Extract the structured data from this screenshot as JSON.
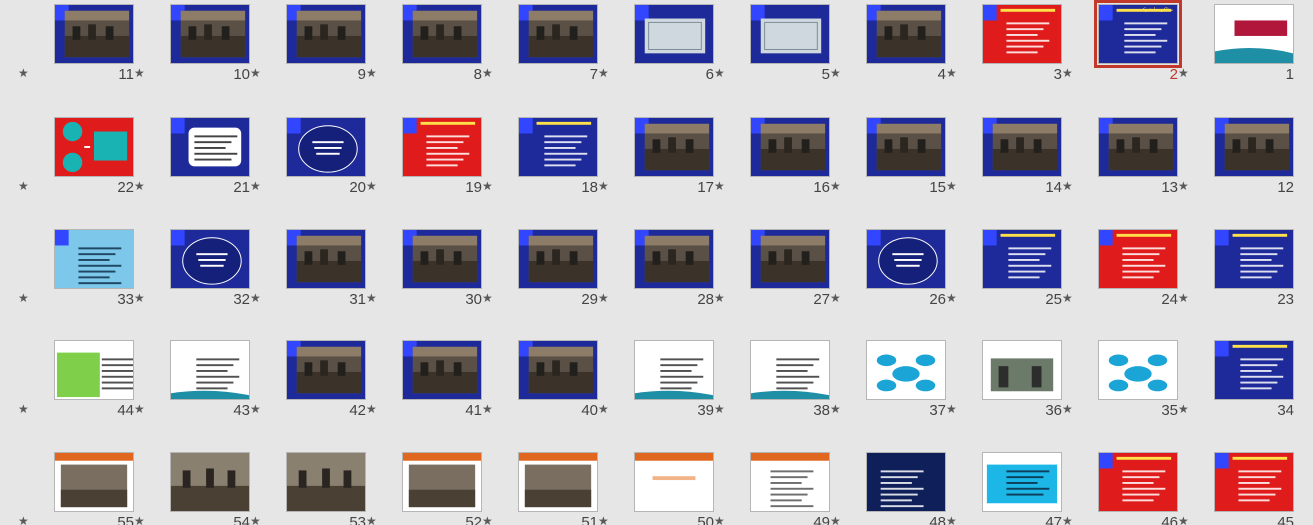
{
  "view": "slide_sorter",
  "selected_slide": "2",
  "star_symbol": "★",
  "colors": {
    "background": "#e6e6e6",
    "selection": "#c0392b",
    "slide_blue": "#1e2a9a",
    "slide_red": "#e01b1b",
    "slide_white": "#ffffff",
    "slide_orange": "#e0671f"
  },
  "slides": [
    {
      "number": "1",
      "theme": "white-title"
    },
    {
      "number": "2",
      "theme": "blue-text",
      "title": "مذاكره با شركت",
      "selected": true
    },
    {
      "number": "3",
      "theme": "red-text"
    },
    {
      "number": "4",
      "theme": "blue-photo"
    },
    {
      "number": "5",
      "theme": "blue-diagram"
    },
    {
      "number": "6",
      "theme": "blue-diagram"
    },
    {
      "number": "7",
      "theme": "blue-photo"
    },
    {
      "number": "8",
      "theme": "blue-photo"
    },
    {
      "number": "9",
      "theme": "blue-photo"
    },
    {
      "number": "10",
      "theme": "blue-photo"
    },
    {
      "number": "11",
      "theme": "blue-photo"
    },
    {
      "number": "12",
      "theme": "blue-photo"
    },
    {
      "number": "13",
      "theme": "blue-photo"
    },
    {
      "number": "14",
      "theme": "blue-photo"
    },
    {
      "number": "15",
      "theme": "blue-photo"
    },
    {
      "number": "16",
      "theme": "blue-photo"
    },
    {
      "number": "17",
      "theme": "blue-photo"
    },
    {
      "number": "18",
      "theme": "blue-text"
    },
    {
      "number": "19",
      "theme": "red-text"
    },
    {
      "number": "20",
      "theme": "blue-circle"
    },
    {
      "number": "21",
      "theme": "blue-white-box"
    },
    {
      "number": "22",
      "theme": "red-circles"
    },
    {
      "number": "23",
      "theme": "blue-text"
    },
    {
      "number": "24",
      "theme": "red-text"
    },
    {
      "number": "25",
      "theme": "blue-text"
    },
    {
      "number": "26",
      "theme": "blue-circle"
    },
    {
      "number": "27",
      "theme": "blue-photo"
    },
    {
      "number": "28",
      "theme": "blue-photo"
    },
    {
      "number": "29",
      "theme": "blue-photo"
    },
    {
      "number": "30",
      "theme": "blue-photo"
    },
    {
      "number": "31",
      "theme": "blue-photo"
    },
    {
      "number": "32",
      "theme": "blue-circle"
    },
    {
      "number": "33",
      "theme": "lightblue-text"
    },
    {
      "number": "34",
      "theme": "blue-text"
    },
    {
      "number": "35",
      "theme": "white-diagram"
    },
    {
      "number": "36",
      "theme": "white-photo"
    },
    {
      "number": "37",
      "theme": "white-diagram"
    },
    {
      "number": "38",
      "theme": "white-text"
    },
    {
      "number": "39",
      "theme": "white-text"
    },
    {
      "number": "40",
      "theme": "blue-photo"
    },
    {
      "number": "41",
      "theme": "blue-photo"
    },
    {
      "number": "42",
      "theme": "blue-photo"
    },
    {
      "number": "43",
      "theme": "white-text"
    },
    {
      "number": "44",
      "theme": "green-text"
    },
    {
      "number": "45",
      "theme": "red-text"
    },
    {
      "number": "46",
      "theme": "red-text"
    },
    {
      "number": "47",
      "theme": "cyan-text"
    },
    {
      "number": "48",
      "theme": "navy-text"
    },
    {
      "number": "49",
      "theme": "orange-text"
    },
    {
      "number": "50",
      "theme": "orange-blank"
    },
    {
      "number": "51",
      "theme": "orange-photo"
    },
    {
      "number": "52",
      "theme": "orange-photo"
    },
    {
      "number": "53",
      "theme": "photo"
    },
    {
      "number": "54",
      "theme": "photo"
    },
    {
      "number": "55",
      "theme": "orange-photo"
    }
  ]
}
